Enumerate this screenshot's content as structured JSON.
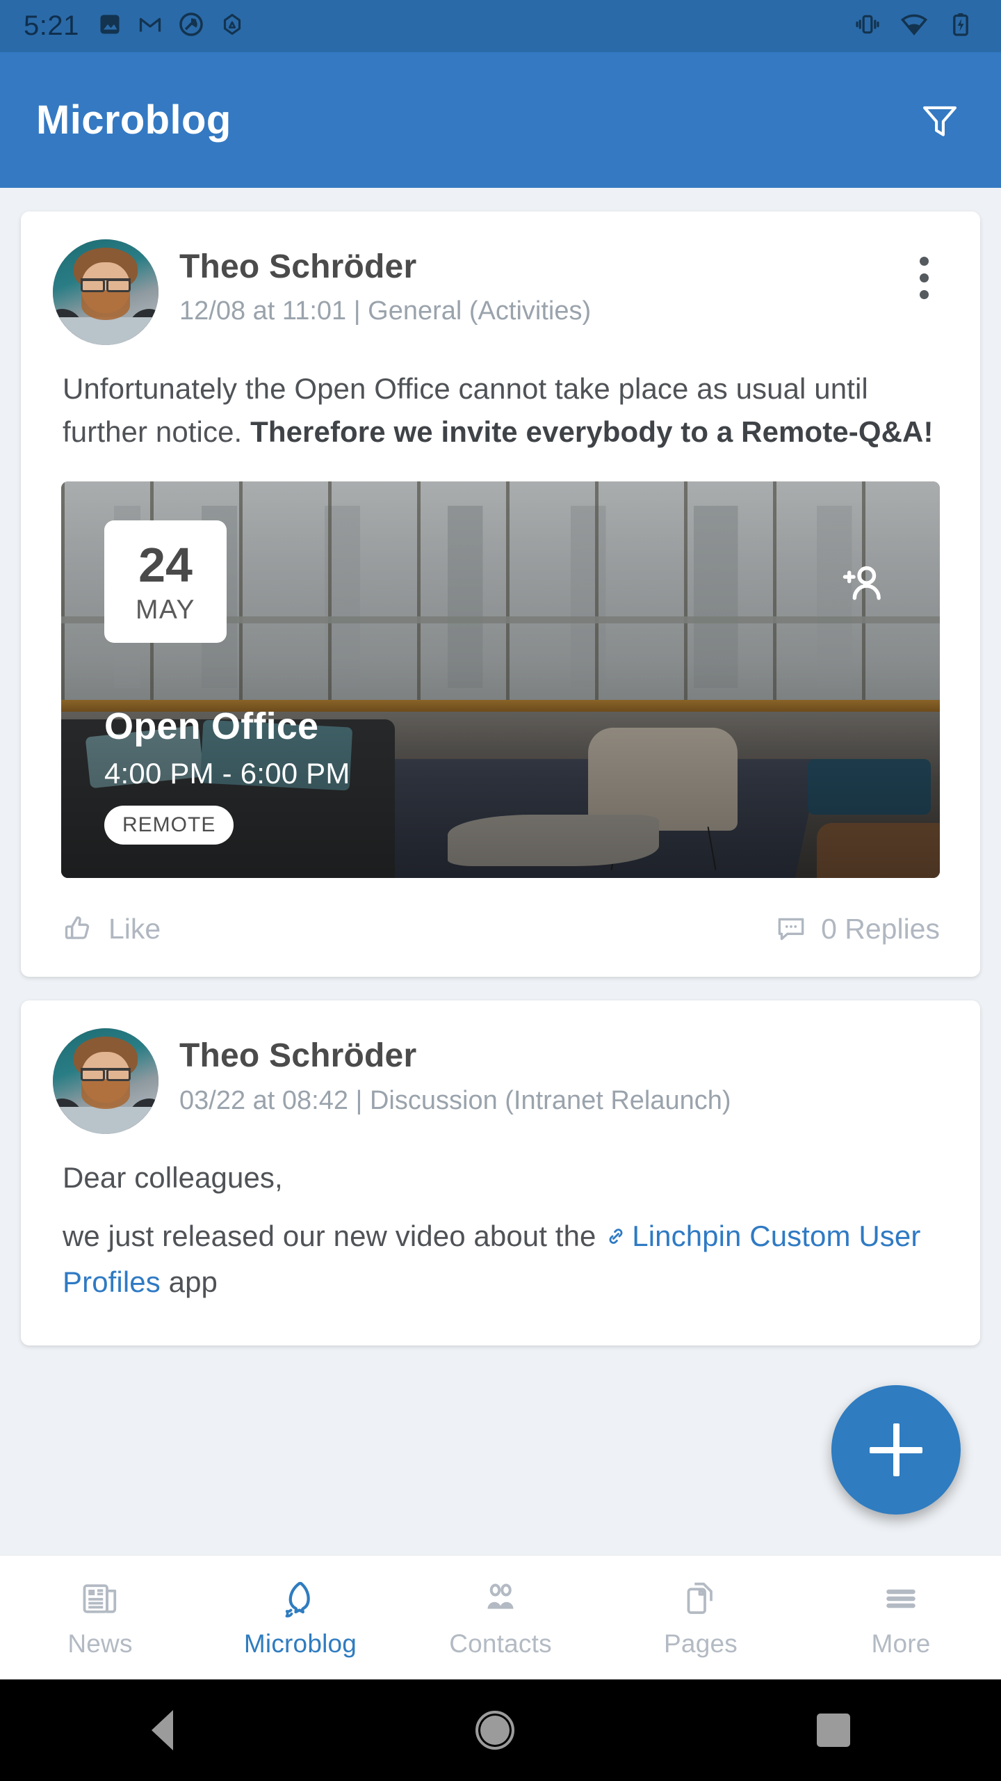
{
  "status_bar": {
    "time": "5:21",
    "left_icons": [
      "image-icon",
      "gmail-icon",
      "app-circle-icon",
      "drive-icon"
    ],
    "right_icons": [
      "vibrate-icon",
      "wifi-icon",
      "battery-charging-icon"
    ],
    "background_color": "#2a6aa8"
  },
  "app_bar": {
    "title": "Microblog",
    "filter_icon": "filter-funnel-icon",
    "background_color": "#3479c2"
  },
  "posts": [
    {
      "author": "Theo Schröder",
      "meta": "12/08 at 11:01 | General (Activities)",
      "menu_icon": "overflow-menu-icon",
      "body_plain": "Unfortunately the Open Office cannot take place as usual until further notice. ",
      "body_bold": "Therefore we invite everybody to a Remote-Q&A!",
      "event": {
        "day": "24",
        "month": "MAY",
        "title": "Open Office",
        "time": "4:00 PM -  6:00 PM",
        "tag": "REMOTE",
        "add_person_icon": "add-person-icon"
      },
      "actions": {
        "like_label": "Like",
        "like_icon": "thumbs-up-icon",
        "replies_label": "0 Replies",
        "replies_icon": "comment-icon"
      }
    },
    {
      "author": "Theo Schröder",
      "meta": "03/22 at 08:42 | Discussion (Intranet Relaunch)",
      "menu_icon": "overflow-menu-icon",
      "line1": "Dear colleagues,",
      "line2_prefix": "we just released our new video about the ",
      "link_icon": "link-icon",
      "link_text": "Linchpin Custom User Profiles",
      "line2_suffix": " app"
    }
  ],
  "fab": {
    "icon": "plus-icon",
    "color": "#2f7cc0"
  },
  "bottom_nav": {
    "items": [
      {
        "label": "News",
        "icon": "newspaper-icon",
        "active": false
      },
      {
        "label": "Microblog",
        "icon": "speech-bubble-icon",
        "active": true
      },
      {
        "label": "Contacts",
        "icon": "people-icon",
        "active": false
      },
      {
        "label": "Pages",
        "icon": "documents-icon",
        "active": false
      },
      {
        "label": "More",
        "icon": "hamburger-icon",
        "active": false
      }
    ],
    "active_color": "#2f7cc0",
    "inactive_color": "#b3bac3"
  },
  "android_nav": {
    "back": "back-triangle-icon",
    "home": "home-circle-icon",
    "recents": "recents-square-icon"
  }
}
